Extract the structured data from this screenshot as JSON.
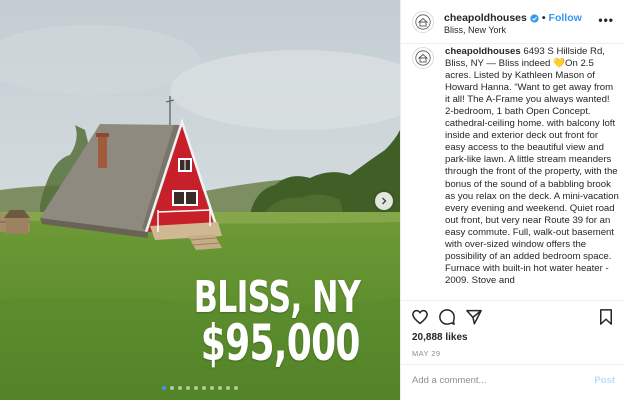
{
  "post": {
    "username": "cheapoldhouses",
    "follow_label": "Follow",
    "separator": "•",
    "location": "Bliss, New York",
    "more_label": "•••"
  },
  "photo": {
    "overlay_city": "BLISS, NY",
    "overlay_price": "$95,000",
    "slide_count": 10,
    "active_slide": 1
  },
  "caption": {
    "username": "cheapoldhouses",
    "text": " 6493 S Hillside Rd, Bliss, NY — Bliss indeed 💛On 2.5 acres. Listed by Kathleen Mason of Howard Hanna. “Want to get away from it all! The A-Frame you always wanted! 2-bedroom, 1 bath Open Concept. cathedral-ceiling home. with balcony loft inside and exterior deck out front for easy access to the beautiful view and park-like lawn. A little stream meanders through the front of the property, with the bonus of the sound of a babbling brook as you relax on the deck. A mini-vacation every evening and weekend. Quiet road out front, but very near Route 39 for an easy commute. Full, walk-out basement with over-sized window offers the possibility of an added bedroom space. Furnace with built-in hot water heater - 2009. Stove and"
  },
  "engagement": {
    "likes": "20,888 likes",
    "date": "MAY 29"
  },
  "comment": {
    "placeholder": "Add a comment...",
    "post_label": "Post"
  },
  "icons": {
    "like": "heart-icon",
    "comment": "speech-bubble-icon",
    "share": "paper-plane-icon",
    "save": "bookmark-icon",
    "verified": "verified-badge-icon",
    "next": "chevron-right-icon"
  },
  "colors": {
    "accent": "#3897f0",
    "post_disabled": "#b2dffc",
    "house_red": "#c8202b",
    "lawn": "#5f8f2e"
  }
}
